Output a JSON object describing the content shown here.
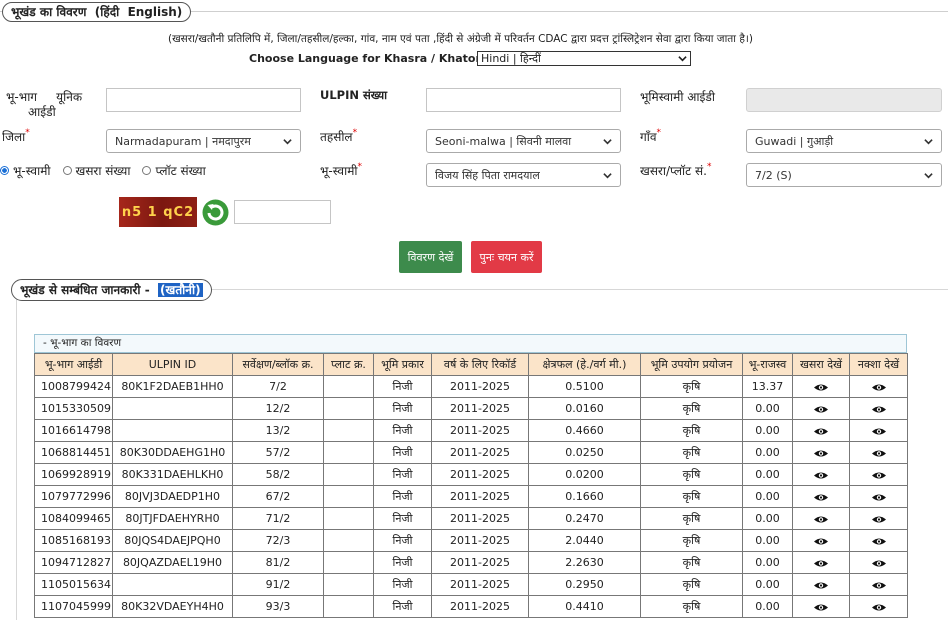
{
  "header": {
    "title": "भूखंड का विवरण",
    "lang_hindi": "(हिंदी",
    "lang_english": "English)"
  },
  "notice": "(खसरा/खतौनी प्रतिलिपि में, जिला/तहसील/हल्का, गांव, नाम एवं पता ,हिंदी से अंग्रेजी में परिवर्तन CDAC द्वारा प्रदत्त ट्रांस्लिट्रेशन सेवा द्वारा किया जाता है।)",
  "language": {
    "label": "Choose Language for Khasra / Khatoni Copy:",
    "selected": "Hindi | हिन्दीं"
  },
  "form": {
    "unique_id_label_1": "भू-भाग",
    "unique_id_label_2": "यूनिक",
    "unique_id_label_3": "आईडी",
    "ulpin_label": "ULPIN संख्या",
    "owner_id_label": "भूमिस्वामी आईडी",
    "district_label": "जिला",
    "district_value": "Narmadapuram | नमदापुरम",
    "tehsil_label": "तहसील",
    "tehsil_value": "Seoni-malwa | सिवनी मालवा",
    "village_label": "गाँव",
    "village_value": "Guwadi | गुआड़ी",
    "radio_owner": "भू-स्वामी",
    "radio_khasra": "खसरा संख्या",
    "radio_plot": "प्लॉट संख्या",
    "owner_label": "भू-स्वामी",
    "owner_value": "विजय सिंह पिता रामदयाल",
    "khasra_label": "खसरा/प्लॉट सं.",
    "khasra_value": "7/2 (S)",
    "required_mark": "*",
    "captcha_text": "n5 1 qC2",
    "view_button": "विवरण देखें",
    "reset_button": "पुनः चयन करें"
  },
  "related": {
    "title": "भूखंड से सम्बंधित जानकारी -",
    "highlight": "(खतौनी)",
    "subheader": "- भू-भाग का विवरण"
  },
  "table": {
    "columns": [
      "भू-भाग आईडी",
      "ULPIN ID",
      "सर्वेक्षण/ब्लॉक क्र.",
      "प्लाट क्र.",
      "भूमि प्रकार",
      "वर्ष के लिए रिकॉर्ड",
      "क्षेत्रफल (हे./वर्ग मी.)",
      "भूमि उपयोग प्रयोजन",
      "भू-राजस्व",
      "खसरा देखें",
      "नक्शा देखें"
    ],
    "rows": [
      [
        "1008799424",
        "80K1F2DAEB1HH0",
        "7/2",
        "",
        "निजी",
        "2011-2025",
        "0.5100",
        "कृषि",
        "13.37"
      ],
      [
        "1015330509",
        "",
        "12/2",
        "",
        "निजी",
        "2011-2025",
        "0.0160",
        "कृषि",
        "0.00"
      ],
      [
        "1016614798",
        "",
        "13/2",
        "",
        "निजी",
        "2011-2025",
        "0.4660",
        "कृषि",
        "0.00"
      ],
      [
        "1068814451",
        "80K30DDAEHG1H0",
        "57/2",
        "",
        "निजी",
        "2011-2025",
        "0.0250",
        "कृषि",
        "0.00"
      ],
      [
        "1069928919",
        "80K331DAEHLKH0",
        "58/2",
        "",
        "निजी",
        "2011-2025",
        "0.0200",
        "कृषि",
        "0.00"
      ],
      [
        "1079772996",
        "80JVJ3DAEDP1H0",
        "67/2",
        "",
        "निजी",
        "2011-2025",
        "0.1660",
        "कृषि",
        "0.00"
      ],
      [
        "1084099465",
        "80JTJFDAEHYRH0",
        "71/2",
        "",
        "निजी",
        "2011-2025",
        "0.2470",
        "कृषि",
        "0.00"
      ],
      [
        "1085168193",
        "80JQS4DAEJPQH0",
        "72/3",
        "",
        "निजी",
        "2011-2025",
        "2.0440",
        "कृषि",
        "0.00"
      ],
      [
        "1094712827",
        "80JQAZDAEL19H0",
        "81/2",
        "",
        "निजी",
        "2011-2025",
        "2.2630",
        "कृषि",
        "0.00"
      ],
      [
        "1105015634",
        "",
        "91/2",
        "",
        "निजी",
        "2011-2025",
        "0.2950",
        "कृषि",
        "0.00"
      ],
      [
        "1107045999",
        "80K32VDAEYH4H0",
        "93/3",
        "",
        "निजी",
        "2011-2025",
        "0.4410",
        "कृषि",
        "0.00"
      ]
    ]
  }
}
